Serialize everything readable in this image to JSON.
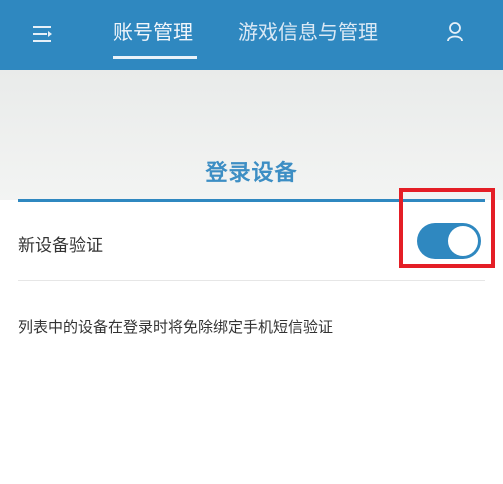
{
  "header": {
    "menu_icon": "menu-icon",
    "tabs": [
      {
        "label": "账号管理",
        "active": true
      },
      {
        "label": "游戏信息与管理",
        "active": false
      }
    ],
    "user_icon": "user-icon",
    "color": "#2f88c0"
  },
  "section": {
    "title": "登录设备"
  },
  "setting": {
    "label": "新设备验证",
    "toggle_on": true,
    "toggle_color": "#2f88c0"
  },
  "note": {
    "text": "列表中的设备在登录时将免除绑定手机短信验证"
  },
  "highlight": {
    "color": "#e41e26"
  }
}
